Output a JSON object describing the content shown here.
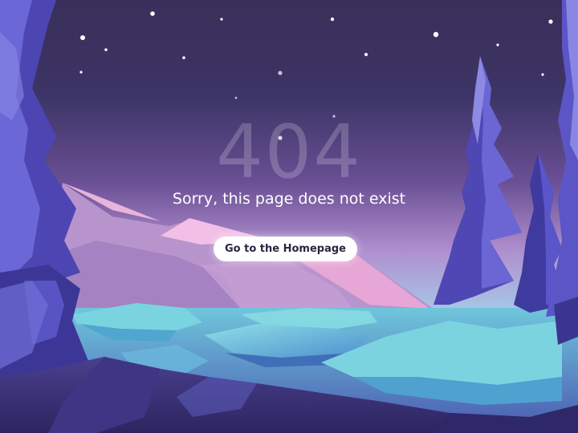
{
  "error": {
    "code": "404",
    "message": "Sorry, this page does not exist"
  },
  "actions": {
    "home_button_label": "Go to the Homepage"
  },
  "illustration": {
    "subject": "night mountain lake landscape with pine trees and stars",
    "colors": {
      "sky_top": "#3a2f5a",
      "sky_mid": "#5c4a8c",
      "sky_horizon": "#b59bd6",
      "mountain": "#c9a6d8",
      "mountain_snow": "#f0c4e6",
      "lake": "#5fb8d6",
      "ice": "#7ad4e0",
      "tree_dark": "#3b2f7a",
      "tree_light": "#6f6bd4",
      "foreground": "#3a2f6e"
    }
  }
}
